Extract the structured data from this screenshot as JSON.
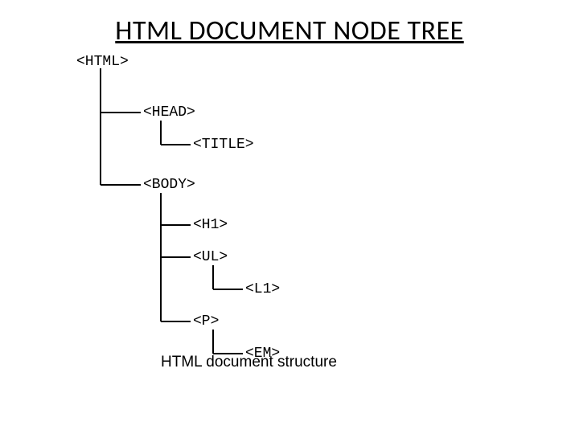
{
  "title": "HTML DOCUMENT NODE TREE",
  "caption": "HTML document structure",
  "nodes": {
    "html": "<HTML>",
    "head": "<HEAD>",
    "title_tag": "<TITLE>",
    "body": "<BODY>",
    "h1": "<H1>",
    "ul": "<UL>",
    "l1": "<L1>",
    "p": "<P>",
    "em": "<EM>"
  }
}
